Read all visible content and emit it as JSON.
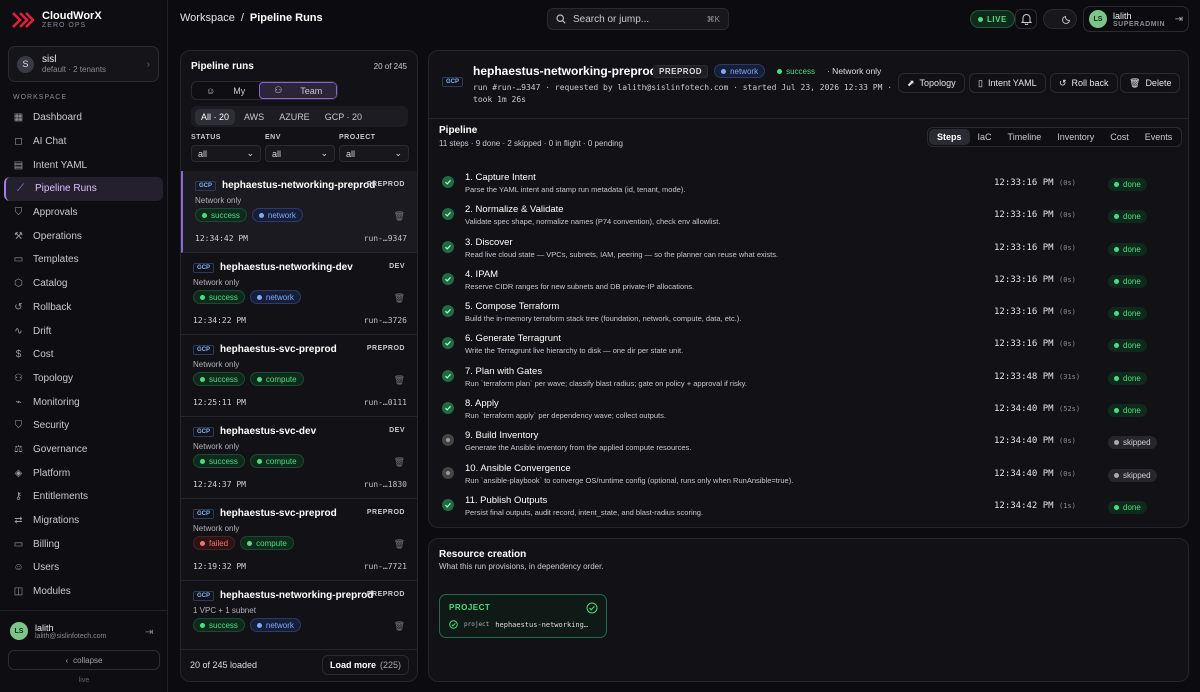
{
  "brand": {
    "name": "CloudWorX",
    "sub": "ZERO OPS",
    "accent": "#e0203c"
  },
  "tenant": {
    "initial": "S",
    "name": "sisl",
    "sub": "default · 2 tenants"
  },
  "sidebar": {
    "section": "WORKSPACE",
    "items": [
      {
        "label": "Dashboard",
        "icon": "dashboard-icon",
        "glyph": "▦"
      },
      {
        "label": "AI Chat",
        "icon": "chat-icon",
        "glyph": "◻"
      },
      {
        "label": "Intent YAML",
        "icon": "document-icon",
        "glyph": "▤"
      },
      {
        "label": "Pipeline Runs",
        "icon": "pipeline-icon",
        "glyph": "⟋"
      },
      {
        "label": "Approvals",
        "icon": "shield-check-icon",
        "glyph": "⛉"
      },
      {
        "label": "Operations",
        "icon": "wrench-icon",
        "glyph": "⚒"
      },
      {
        "label": "Templates",
        "icon": "template-icon",
        "glyph": "▭"
      },
      {
        "label": "Catalog",
        "icon": "box-icon",
        "glyph": "⬡"
      },
      {
        "label": "Rollback",
        "icon": "undo-icon",
        "glyph": "↺"
      },
      {
        "label": "Drift",
        "icon": "activity-icon",
        "glyph": "∿"
      },
      {
        "label": "Cost",
        "icon": "dollar-icon",
        "glyph": "$"
      },
      {
        "label": "Topology",
        "icon": "network-icon",
        "glyph": "⚇"
      },
      {
        "label": "Monitoring",
        "icon": "chart-icon",
        "glyph": "⌁"
      },
      {
        "label": "Security",
        "icon": "shield-icon",
        "glyph": "⛉"
      },
      {
        "label": "Governance",
        "icon": "gavel-icon",
        "glyph": "⚖"
      },
      {
        "label": "Platform",
        "icon": "layers-icon",
        "glyph": "◈"
      },
      {
        "label": "Entitlements",
        "icon": "key-icon",
        "glyph": "⚷"
      },
      {
        "label": "Migrations",
        "icon": "swap-icon",
        "glyph": "⇄"
      },
      {
        "label": "Billing",
        "icon": "card-icon",
        "glyph": "▭"
      },
      {
        "label": "Users",
        "icon": "users-icon",
        "glyph": "☺"
      },
      {
        "label": "Modules",
        "icon": "cube-icon",
        "glyph": "◫"
      }
    ],
    "active_index": 3,
    "user": {
      "initials": "LS",
      "name": "lalith",
      "email": "lalith@sislinfotech.com"
    },
    "collapse": "collapse",
    "status": "live"
  },
  "topbar": {
    "crumb_root": "Workspace",
    "crumb_sep": "/",
    "crumb_current": "Pipeline Runs",
    "search_placeholder": "Search or jump...",
    "search_kbd": "⌘K",
    "live": "LIVE",
    "user_initials": "LS",
    "user_name": "lalith",
    "user_role": "SUPERADMIN"
  },
  "runs": {
    "title": "Pipeline runs",
    "count": "20 of 245",
    "scope_my": "My",
    "scope_team": "Team",
    "cloud_filters": [
      "All · 20",
      "AWS",
      "AZURE",
      "GCP · 20"
    ],
    "status_label": "STATUS",
    "status_value": "all",
    "env_label": "ENV",
    "env_value": "all",
    "project_label": "PROJECT",
    "project_value": "all",
    "items": [
      {
        "cloud": "GCP",
        "name": "hephaestus-networking-preprod",
        "env": "PREPROD",
        "sub": "Network only",
        "status": "success",
        "kind": "network",
        "time": "12:34:42 PM",
        "id": "run-…9347"
      },
      {
        "cloud": "GCP",
        "name": "hephaestus-networking-dev",
        "env": "DEV",
        "sub": "Network only",
        "status": "success",
        "kind": "network",
        "time": "12:34:22 PM",
        "id": "run-…3726"
      },
      {
        "cloud": "GCP",
        "name": "hephaestus-svc-preprod",
        "env": "PREPROD",
        "sub": "Network only",
        "status": "success",
        "kind": "compute",
        "time": "12:25:11 PM",
        "id": "run-…0111"
      },
      {
        "cloud": "GCP",
        "name": "hephaestus-svc-dev",
        "env": "DEV",
        "sub": "Network only",
        "status": "success",
        "kind": "compute",
        "time": "12:24:37 PM",
        "id": "run-…1830"
      },
      {
        "cloud": "GCP",
        "name": "hephaestus-svc-preprod",
        "env": "PREPROD",
        "sub": "Network only",
        "status": "failed",
        "kind": "compute",
        "time": "12:19:32 PM",
        "id": "run-…7721"
      },
      {
        "cloud": "GCP",
        "name": "hephaestus-networking-preprod",
        "env": "PREPROD",
        "sub": "1 VPC + 1 subnet",
        "status": "success",
        "kind": "network",
        "time": "",
        "id": ""
      }
    ],
    "loaded": "20 of 245 loaded",
    "load_more": "Load more",
    "load_more_count": "(225)"
  },
  "detail": {
    "cloud": "GCP",
    "name": "hephaestus-networking-preprod",
    "env": "PREPROD",
    "kind": "network",
    "status": "success",
    "scope": "· Network only",
    "meta": "run #run-…9347 · requested by lalith@sislinfotech.com · started Jul 23, 2026 12:33 PM · took 1m 26s",
    "buttons": {
      "topology": "Topology",
      "intent": "Intent YAML",
      "rollback": "Roll back",
      "delete": "Delete"
    },
    "pipeline_title": "Pipeline",
    "pipeline_sub": "11 steps · 9 done · 2 skipped · 0 in flight · 0 pending",
    "tabs": [
      "Steps",
      "IaC",
      "Timeline",
      "Inventory",
      "Cost",
      "Events"
    ],
    "steps": [
      {
        "title": "1. Capture Intent",
        "desc": "Parse the YAML intent and stamp run metadata (id, tenant, mode).",
        "time": "12:33:16 PM",
        "dur": "(0s)",
        "state": "done"
      },
      {
        "title": "2. Normalize & Validate",
        "desc": "Validate spec shape, normalize names (P74 convention), check env allowlist.",
        "time": "12:33:16 PM",
        "dur": "(0s)",
        "state": "done"
      },
      {
        "title": "3. Discover",
        "desc": "Read live cloud state — VPCs, subnets, IAM, peering — so the planner can reuse what exists.",
        "time": "12:33:16 PM",
        "dur": "(0s)",
        "state": "done"
      },
      {
        "title": "4. IPAM",
        "desc": "Reserve CIDR ranges for new subnets and DB private-IP allocations.",
        "time": "12:33:16 PM",
        "dur": "(0s)",
        "state": "done"
      },
      {
        "title": "5. Compose Terraform",
        "desc": "Build the in-memory terraform stack tree (foundation, network, compute, data, etc.).",
        "time": "12:33:16 PM",
        "dur": "(0s)",
        "state": "done"
      },
      {
        "title": "6. Generate Terragrunt",
        "desc": "Write the Terragrunt live hierarchy to disk — one dir per state unit.",
        "time": "12:33:16 PM",
        "dur": "(0s)",
        "state": "done"
      },
      {
        "title": "7. Plan with Gates",
        "desc": "Run `terraform plan` per wave; classify blast radius; gate on policy + approval if risky.",
        "time": "12:33:48 PM",
        "dur": "(31s)",
        "state": "done"
      },
      {
        "title": "8. Apply",
        "desc": "Run `terraform apply` per dependency wave; collect outputs.",
        "time": "12:34:40 PM",
        "dur": "(52s)",
        "state": "done"
      },
      {
        "title": "9. Build Inventory",
        "desc": "Generate the Ansible inventory from the applied compute resources.",
        "time": "12:34:40 PM",
        "dur": "(0s)",
        "state": "skipped"
      },
      {
        "title": "10. Ansible Convergence",
        "desc": "Run `ansible-playbook` to converge OS/runtime config (optional, runs only when RunAnsible=true).",
        "time": "12:34:40 PM",
        "dur": "(0s)",
        "state": "skipped"
      },
      {
        "title": "11. Publish Outputs",
        "desc": "Persist final outputs, audit record, intent_state, and blast-radius scoring.",
        "time": "12:34:42 PM",
        "dur": "(1s)",
        "state": "done"
      }
    ]
  },
  "resources": {
    "title": "Resource creation",
    "sub": "What this run provisions, in dependency order.",
    "group": "PROJECT",
    "item_kind": "project",
    "item_name": "hephaestus-networking…"
  }
}
